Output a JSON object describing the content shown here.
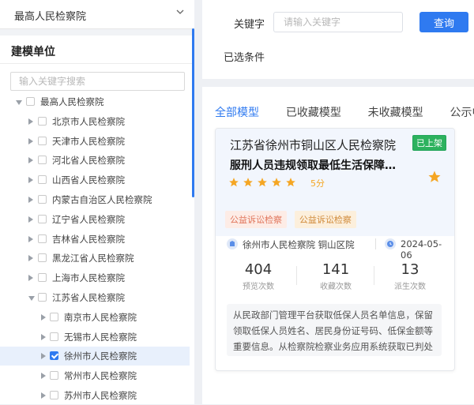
{
  "top_select": {
    "value": "最高人民检察院"
  },
  "left_panel": {
    "title": "建模单位",
    "search_placeholder": "输入关键字搜索",
    "tree": [
      {
        "label": "最高人民检察院",
        "level": 0,
        "expanded": true,
        "checked": false
      },
      {
        "label": "北京市人民检察院",
        "level": 1,
        "expanded": false,
        "checked": false
      },
      {
        "label": "天津市人民检察院",
        "level": 1,
        "expanded": false,
        "checked": false
      },
      {
        "label": "河北省人民检察院",
        "level": 1,
        "expanded": false,
        "checked": false
      },
      {
        "label": "山西省人民检察院",
        "level": 1,
        "expanded": false,
        "checked": false
      },
      {
        "label": "内蒙古自治区人民检察院",
        "level": 1,
        "expanded": false,
        "checked": false
      },
      {
        "label": "辽宁省人民检察院",
        "level": 1,
        "expanded": false,
        "checked": false
      },
      {
        "label": "吉林省人民检察院",
        "level": 1,
        "expanded": false,
        "checked": false
      },
      {
        "label": "黑龙江省人民检察院",
        "level": 1,
        "expanded": false,
        "checked": false
      },
      {
        "label": "上海市人民检察院",
        "level": 1,
        "expanded": false,
        "checked": false
      },
      {
        "label": "江苏省人民检察院",
        "level": 1,
        "expanded": true,
        "checked": false
      },
      {
        "label": "南京市人民检察院",
        "level": 2,
        "expanded": false,
        "checked": false
      },
      {
        "label": "无锡市人民检察院",
        "level": 2,
        "expanded": false,
        "checked": false
      },
      {
        "label": "徐州市人民检察院",
        "level": 2,
        "expanded": false,
        "checked": true,
        "selected": true
      },
      {
        "label": "常州市人民检察院",
        "level": 2,
        "expanded": false,
        "checked": false
      },
      {
        "label": "苏州市人民检察院",
        "level": 2,
        "expanded": false,
        "checked": false
      }
    ]
  },
  "filter": {
    "keyword_label": "关键字",
    "keyword_placeholder": "请输入关键字",
    "query_label": "查询",
    "conditions_label": "已选条件"
  },
  "tabs": [
    {
      "label": "全部模型",
      "active": true
    },
    {
      "label": "已收藏模型",
      "active": false
    },
    {
      "label": "未收藏模型",
      "active": false
    },
    {
      "label": "公示中",
      "active": false
    }
  ],
  "card": {
    "court": "江苏省徐州市铜山区人民检察院",
    "status_badge": "已上架",
    "title": "服刑人员违规领取最低生活保障金监督模型",
    "rating_stars": 5,
    "score_text": "5分",
    "tags": [
      "公益诉讼检察",
      "公益诉讼检察"
    ],
    "org": "徐州市人民检察院 铜山区院",
    "date": "2024-05-06",
    "stats": [
      {
        "value": "404",
        "label": "预览次数"
      },
      {
        "value": "141",
        "label": "收藏次数"
      },
      {
        "value": "13",
        "label": "派生次数"
      }
    ],
    "description": "从民政部门管理平台获取低保人员名单信息，保留领取低保人员姓名、居民身份证号码、低保金额等重要信息。从检察院检察业务应用系统获取已判处刑罚人员信息"
  },
  "colors": {
    "accent": "#2f7af0",
    "badge_green": "#2db25e",
    "star": "#f5a623",
    "tag_text": "#e0745a"
  }
}
